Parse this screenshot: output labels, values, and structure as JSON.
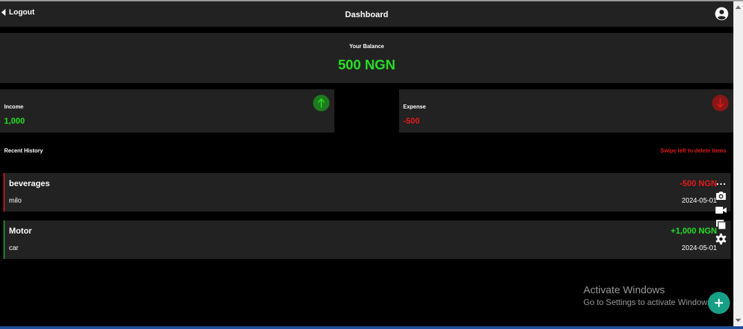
{
  "header": {
    "logout_label": "Logout",
    "title": "Dashboard",
    "avatar_icon": "account-circle-icon"
  },
  "balance": {
    "label": "Your Balance",
    "amount": "500 NGN",
    "amount_color": "#22e022"
  },
  "income": {
    "label": "Income",
    "value": "1,000",
    "icon": "arrow-up-icon",
    "color": "#22e022"
  },
  "expense": {
    "label": "Expense",
    "value": "-500",
    "icon": "arrow-down-icon",
    "color": "#e21a1a"
  },
  "history": {
    "title": "Recent History",
    "hint": "Swipe left to delete items",
    "items": [
      {
        "category": "beverages",
        "note": "milo",
        "amount": "-500 NGN",
        "date": "2024-05-01",
        "type": "expense"
      },
      {
        "category": "Motor",
        "note": "car",
        "amount": "+1,000 NGN",
        "date": "2024-05-01",
        "type": "income"
      }
    ]
  },
  "floating_toolbar": {
    "icons": [
      "more-icon",
      "camera-icon",
      "video-icon",
      "copy-icon",
      "gear-icon"
    ]
  },
  "watermark": {
    "line1": "Activate Windows",
    "line2": "Go to Settings to activate Windows."
  },
  "fab": {
    "label": "+",
    "icon": "plus-icon",
    "color": "#16a085"
  }
}
